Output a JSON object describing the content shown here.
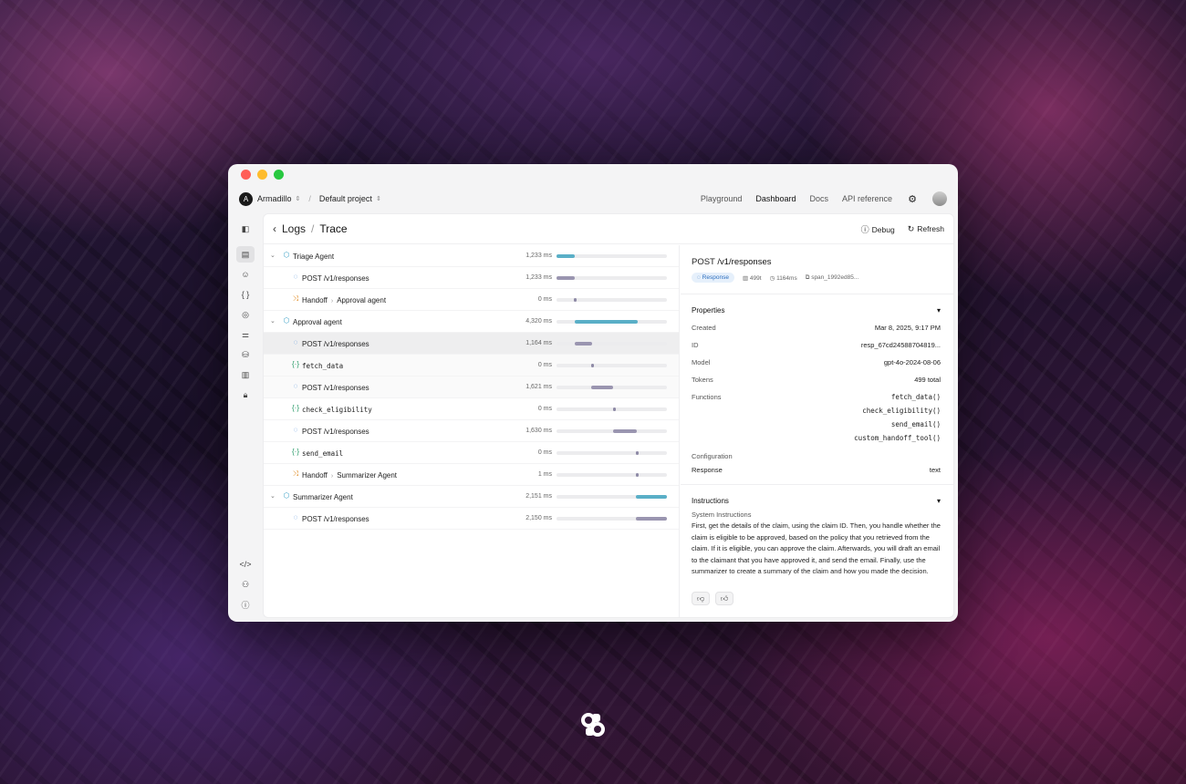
{
  "topbar": {
    "org_initial": "A",
    "org": "Armadillo",
    "project": "Default project",
    "nav": [
      "Playground",
      "Dashboard",
      "Docs",
      "API reference"
    ],
    "active_nav": "Dashboard"
  },
  "header": {
    "logs": "Logs",
    "trace": "Trace",
    "debug": "Debug",
    "refresh": "Refresh"
  },
  "sidebar_icons": [
    "sidebar-toggle-icon",
    "logs-icon",
    "assistants-icon",
    "functions-icon",
    "explore-icon",
    "settings-sliders-icon",
    "storage-icon",
    "usage-chart-icon",
    "lock-icon",
    "code-icon",
    "team-icon",
    "help-icon"
  ],
  "trace": [
    {
      "label": "Triage Agent",
      "type": "agent",
      "duration": "1,233 ms",
      "start": 0.0,
      "width": 0.165
    },
    {
      "label": "POST",
      "label2": "/v1/responses",
      "type": "response",
      "duration": "1,233 ms",
      "start": 0.0,
      "width": 0.165
    },
    {
      "label": "Handoff",
      "label2": "Approval agent",
      "type": "handoff",
      "duration": "0 ms",
      "start": 0.16,
      "width": 0.02
    },
    {
      "label": "Approval agent",
      "type": "agent",
      "duration": "4,320 ms",
      "start": 0.165,
      "width": 0.57
    },
    {
      "label": "POST",
      "label2": "/v1/responses",
      "type": "response",
      "duration": "1,164 ms",
      "start": 0.165,
      "width": 0.16
    },
    {
      "label": "fetch_data",
      "type": "function",
      "duration": "0 ms",
      "start": 0.315,
      "width": 0.02
    },
    {
      "label": "POST",
      "label2": "/v1/responses",
      "type": "response",
      "duration": "1,621 ms",
      "start": 0.315,
      "width": 0.2
    },
    {
      "label": "check_eligibility",
      "type": "function",
      "duration": "0 ms",
      "start": 0.51,
      "width": 0.02
    },
    {
      "label": "POST",
      "label2": "/v1/responses",
      "type": "response",
      "duration": "1,630 ms",
      "start": 0.51,
      "width": 0.215
    },
    {
      "label": "send_email",
      "type": "function",
      "duration": "0 ms",
      "start": 0.715,
      "width": 0.02
    },
    {
      "label": "Handoff",
      "label2": "Summarizer Agent",
      "type": "handoff",
      "duration": "1 ms",
      "start": 0.715,
      "width": 0.02
    },
    {
      "label": "Summarizer Agent",
      "type": "agent",
      "duration": "2,151 ms",
      "start": 0.72,
      "width": 0.28
    },
    {
      "label": "POST",
      "label2": "/v1/responses",
      "type": "response",
      "duration": "2,150 ms",
      "start": 0.72,
      "width": 0.28
    }
  ],
  "detail": {
    "method": "POST",
    "path": "/v1/responses",
    "badge": "Response",
    "tokens_short": "499t",
    "latency": "1164ms",
    "span": "span_1992ed85...",
    "properties_title": "Properties",
    "properties": [
      {
        "k": "Created",
        "v": "Mar 8, 2025, 9:17 PM"
      },
      {
        "k": "ID",
        "v": "resp_67cd24588704819..."
      },
      {
        "k": "Model",
        "v": "gpt-4o-2024-08-06"
      },
      {
        "k": "Tokens",
        "v": "499 total"
      }
    ],
    "functions_label": "Functions",
    "functions": [
      "fetch_data()",
      "check_eligibility()",
      "send_email()",
      "custom_handoff_tool()"
    ],
    "configuration_label": "Configuration",
    "response_label": "Response",
    "response_value": "text",
    "instructions_title": "Instructions",
    "system_instructions_label": "System Instructions",
    "system_instructions": "First, get the details of the claim, using the claim ID. Then, you handle whether the claim is eligible to be approved, based on the policy that you retrieved from the claim. If it is eligible, you can approve the claim. Afterwards, you will draft an email to the claimant that you have approved it, and send the email. Finally, use the summarizer to create a summary of the claim and how you made the decision."
  },
  "colors": {
    "agent_bar": "#5aafc7",
    "response_bar": "#9a95b0",
    "tiny_bar": "#8e8aa6",
    "badge": "#e6f0fb"
  }
}
